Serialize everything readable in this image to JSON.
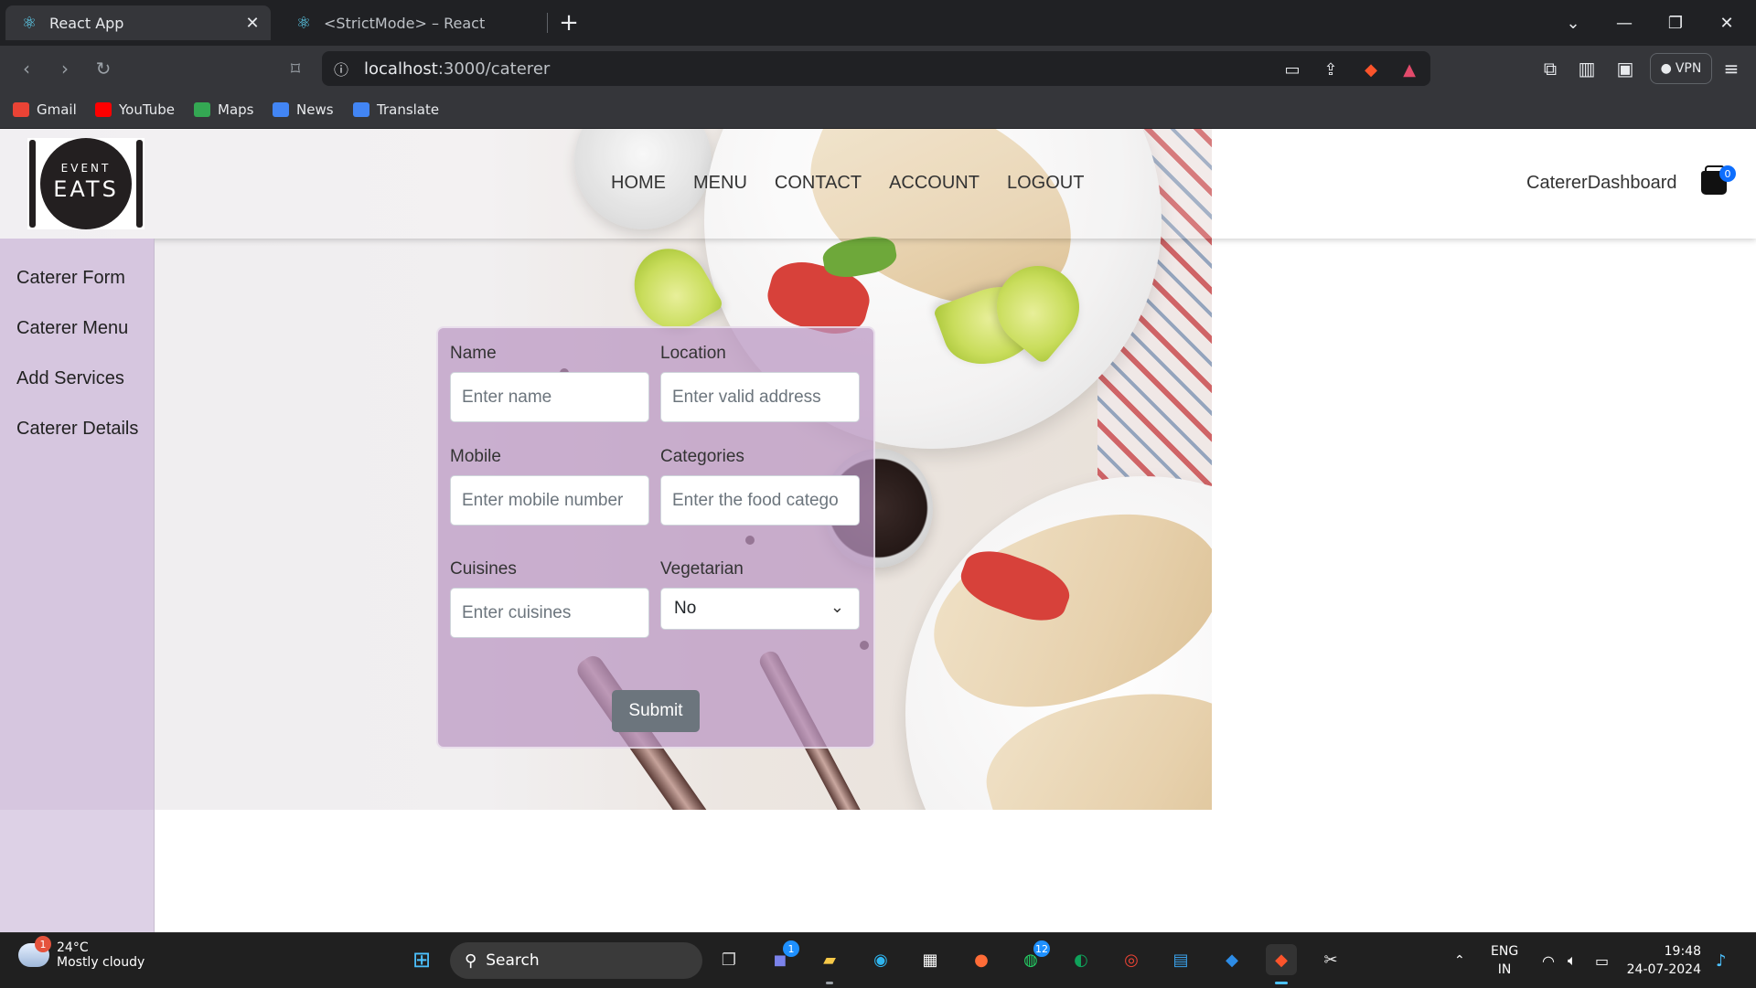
{
  "browser": {
    "tabs": [
      {
        "title": "React App",
        "active": true
      },
      {
        "title": "<StrictMode> – React",
        "active": false
      }
    ],
    "url_host": "localhost",
    "url_path": ":3000/caterer",
    "vpn_label": "VPN",
    "bookmarks": [
      {
        "label": "Gmail",
        "icon": "gmail-icon",
        "color": "#ea4335"
      },
      {
        "label": "YouTube",
        "icon": "youtube-icon",
        "color": "#ff0000"
      },
      {
        "label": "Maps",
        "icon": "maps-icon",
        "color": "#34a853"
      },
      {
        "label": "News",
        "icon": "news-icon",
        "color": "#4285f4"
      },
      {
        "label": "Translate",
        "icon": "translate-icon",
        "color": "#4285f4"
      }
    ]
  },
  "header": {
    "logo_line1": "EVENT",
    "logo_line2": "EATS",
    "nav": [
      "HOME",
      "MENU",
      "CONTACT",
      "ACCOUNT",
      "LOGOUT"
    ],
    "dashboard_label": "CatererDashboard",
    "cart_count": "0"
  },
  "sidebar": {
    "items": [
      "Caterer Form",
      "Caterer Menu",
      "Add Services",
      "Caterer Details"
    ]
  },
  "form": {
    "name_label": "Name",
    "name_placeholder": "Enter name",
    "location_label": "Location",
    "location_placeholder": "Enter valid address",
    "mobile_label": "Mobile",
    "mobile_placeholder": "Enter mobile number",
    "categories_label": "Categories",
    "categories_placeholder": "Enter the food catego",
    "cuisines_label": "Cuisines",
    "cuisines_placeholder": "Enter cuisines",
    "vegetarian_label": "Vegetarian",
    "vegetarian_value": "No",
    "submit_label": "Submit"
  },
  "taskbar": {
    "weather_badge": "1",
    "temperature": "24°C",
    "condition": "Mostly cloudy",
    "search_label": "Search",
    "teams_badge": "1",
    "whatsapp_badge": "12",
    "lang_line1": "ENG",
    "lang_line2": "IN",
    "time": "19:48",
    "date": "24-07-2024"
  },
  "colors": {
    "sidebar_bg": "#ddd1e6",
    "form_bg": "#ba96c2",
    "submit_bg": "#6c757d",
    "badge_blue": "#0d6efd"
  }
}
